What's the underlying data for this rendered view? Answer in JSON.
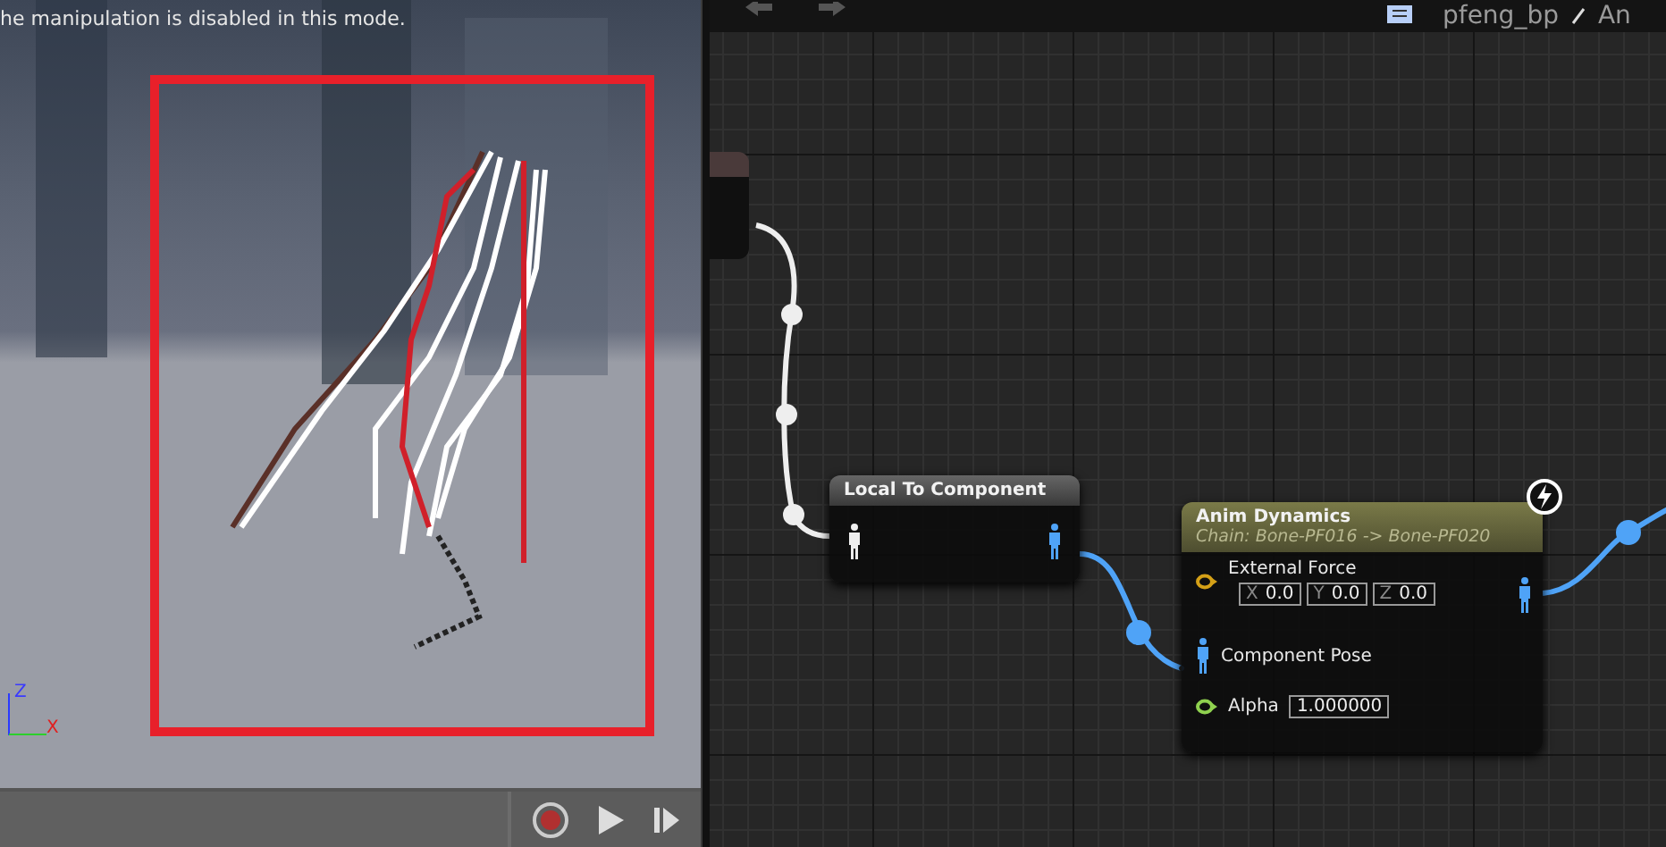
{
  "viewport": {
    "message": "he manipulation is disabled in this mode.",
    "axes": [
      {
        "label": "Z",
        "color": "#3a3aff"
      },
      {
        "label": "X",
        "color": "#e02020"
      }
    ]
  },
  "graph": {
    "breadcrumb": [
      "pfeng_bp",
      "An"
    ],
    "nodes": [
      {
        "kind": "simple",
        "title": "Local To Component"
      },
      {
        "kind": "dynamics",
        "title": "Anim Dynamics",
        "subtitle": "Chain: Bone-PF016 -> Bone-PF020",
        "inputs": [
          {
            "kind": "vector",
            "label": "External Force",
            "components": [
              {
                "axis": "X",
                "value": "0.0"
              },
              {
                "axis": "Y",
                "value": "0.0"
              },
              {
                "axis": "Z",
                "value": "0.0"
              }
            ]
          },
          {
            "kind": "pose",
            "label": "Component Pose"
          },
          {
            "kind": "float",
            "label": "Alpha",
            "value": "1.000000"
          }
        ]
      }
    ]
  }
}
